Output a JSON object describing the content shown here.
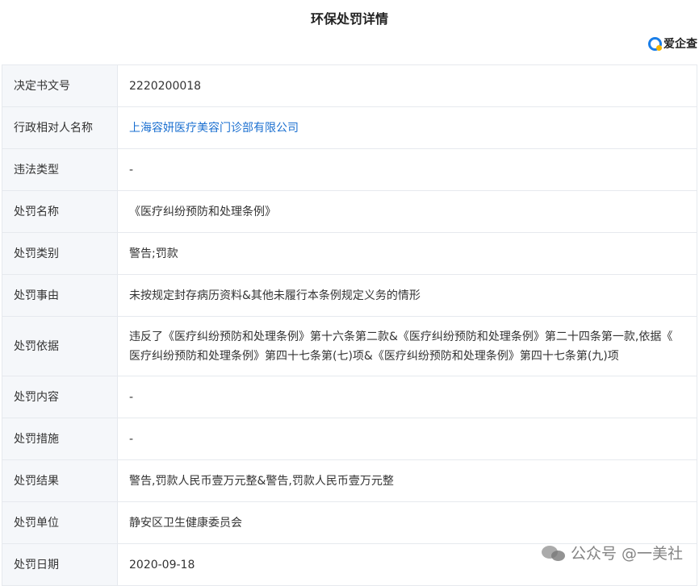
{
  "page": {
    "title": "环保处罚详情"
  },
  "brand": {
    "logo_text": "爱企查",
    "logo_icon": "magnifier-logo-icon",
    "accent_color": "#1a7ee8"
  },
  "rows": [
    {
      "label": "决定书文号",
      "value": "2220200018"
    },
    {
      "label": "行政相对人名称",
      "value": "上海容妍医疗美容门诊部有限公司",
      "link_color": "#1a6fd0"
    },
    {
      "label": "违法类型",
      "value": "-"
    },
    {
      "label": "处罚名称",
      "value": "《医疗纠纷预防和处理条例》"
    },
    {
      "label": "处罚类别",
      "value": "警告;罚款"
    },
    {
      "label": "处罚事由",
      "value": "未按规定封存病历资料&其他未履行本条例规定义务的情形"
    },
    {
      "label": "处罚依据",
      "value_line1": "违反了《医疗纠纷预防和处理条例》第十六条第二款&《医疗纠纷预防和处理条例》第二十四条第一款,依据《",
      "value_line2": "医疗纠纷预防和处理条例》第四十七条第(七)项&《医疗纠纷预防和处理条例》第四十七条第(九)项"
    },
    {
      "label": "处罚内容",
      "value": "-"
    },
    {
      "label": "处罚措施",
      "value": "-"
    },
    {
      "label": "处罚结果",
      "value": "警告,罚款人民币壹万元整&警告,罚款人民币壹万元整"
    },
    {
      "label": "处罚单位",
      "value": "静安区卫生健康委员会"
    },
    {
      "label": "处罚日期",
      "value": "2020-09-18"
    }
  ],
  "watermark": {
    "text": "公众号 @一美社",
    "icon": "wechat-icon"
  }
}
